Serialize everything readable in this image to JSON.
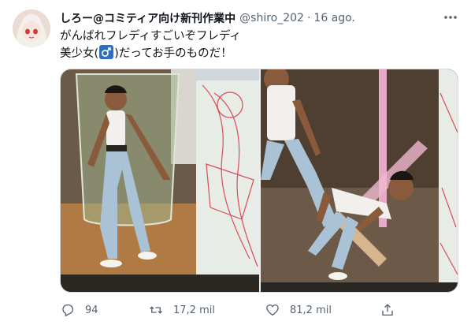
{
  "tweet": {
    "author": {
      "display_name": "しろー@コミティア向け新刊作業中",
      "handle": "@shiro_202",
      "separator": "·",
      "time": "16 ago."
    },
    "text": {
      "line1": "がんばれフレディすごいぞフレディ",
      "line2_before": "美少女(",
      "line2_after": ")だってお手のものだ！"
    },
    "media": {
      "count": 2
    },
    "actions": {
      "reply_count": "94",
      "retweet_count": "17,2 mil",
      "like_count": "81,2 mil"
    },
    "icons": {
      "avatar": "avatar-image",
      "more": "more-horizontal-icon",
      "emoji": "male-sign-emoji",
      "reply": "reply-icon",
      "retweet": "retweet-icon",
      "like": "heart-icon",
      "share": "share-icon"
    },
    "colors": {
      "text": "#0f1419",
      "secondary": "#536471",
      "border": "#cfd9de",
      "emoji_bg": "#2f6fc2"
    }
  }
}
